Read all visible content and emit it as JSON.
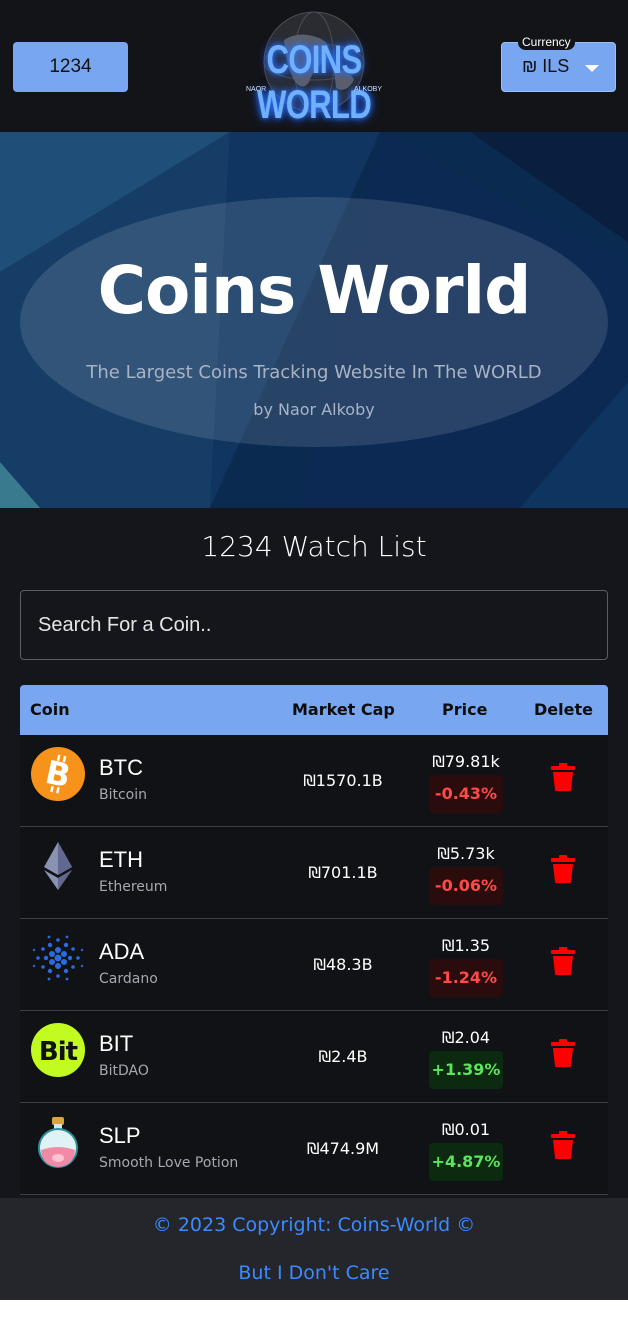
{
  "header": {
    "user_button": "1234",
    "logo": {
      "title": "COINS WORLD",
      "sub_left": "NAOR",
      "sub_right": "ALKOBY"
    },
    "currency": {
      "legend": "Currency",
      "value": "₪ ILS"
    }
  },
  "hero": {
    "title": "Coins World",
    "subtitle": "The Largest Coins Tracking Website In The WORLD",
    "byline": "by Naor Alkoby"
  },
  "watchlist": {
    "title": "1234 Watch List",
    "search_placeholder": "Search For a Coin..",
    "columns": [
      "Coin",
      "Market Cap",
      "Price",
      "Delete"
    ],
    "rows": [
      {
        "symbol": "BTC",
        "name": "Bitcoin",
        "market_cap": "₪1570.1B",
        "price": "₪79.81k",
        "change": "-0.43%",
        "direction": "down",
        "icon": "bitcoin-icon"
      },
      {
        "symbol": "ETH",
        "name": "Ethereum",
        "market_cap": "₪701.1B",
        "price": "₪5.73k",
        "change": "-0.06%",
        "direction": "down",
        "icon": "ethereum-icon"
      },
      {
        "symbol": "ADA",
        "name": "Cardano",
        "market_cap": "₪48.3B",
        "price": "₪1.35",
        "change": "-1.24%",
        "direction": "down",
        "icon": "cardano-icon"
      },
      {
        "symbol": "BIT",
        "name": "BitDAO",
        "market_cap": "₪2.4B",
        "price": "₪2.04",
        "change": "+1.39%",
        "direction": "up",
        "icon": "bitdao-icon"
      },
      {
        "symbol": "SLP",
        "name": "Smooth Love Potion",
        "market_cap": "₪474.9M",
        "price": "₪0.01",
        "change": "+4.87%",
        "direction": "up",
        "icon": "potion-icon"
      }
    ]
  },
  "footer": {
    "copyright": "© 2023 Copyright: Coins-World ©",
    "tagline": "But I Don't Care"
  },
  "colors": {
    "accent": "#78a6f0",
    "negative": "#ff4a4a",
    "positive": "#5ee35e",
    "delete": "#ff0000",
    "link": "#3b8bff"
  }
}
